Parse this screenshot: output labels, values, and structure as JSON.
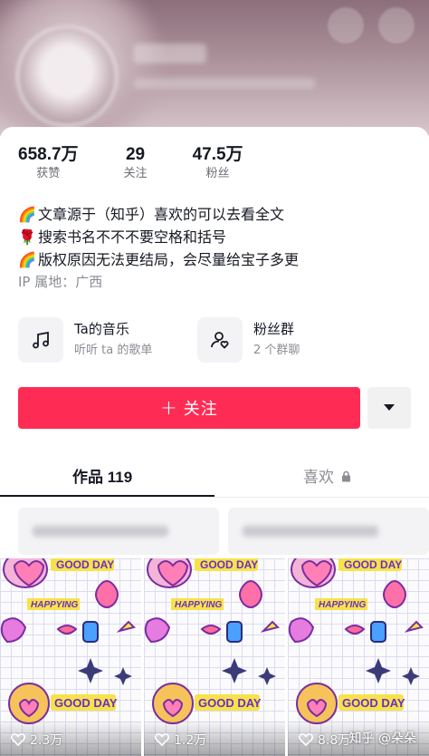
{
  "profile": {
    "stats": [
      {
        "value": "658.7万",
        "label": "获赞"
      },
      {
        "value": "29",
        "label": "关注"
      },
      {
        "value": "47.5万",
        "label": "粉丝"
      }
    ],
    "bio": [
      {
        "emoji": "🌈",
        "text": "文章源于（知乎）喜欢的可以去看全文"
      },
      {
        "emoji": "🌹",
        "text": "搜索书名不不不要空格和括号"
      },
      {
        "emoji": "🌈",
        "text": "版权原因无法更结局，会尽量给宝子多更"
      }
    ],
    "ip": "IP 属地：广西"
  },
  "tiles": [
    {
      "title": "Ta的音乐",
      "sub": "听听 ta 的歌单",
      "icon": "music-note-icon"
    },
    {
      "title": "粉丝群",
      "sub": "2 个群聊",
      "icon": "group-heart-icon"
    }
  ],
  "follow": {
    "label": "关注",
    "plus": "+"
  },
  "tabs": {
    "works": "作品 119",
    "likes": "喜欢"
  },
  "videos": [
    {
      "likes": "2.3万"
    },
    {
      "likes": "1.2万"
    },
    {
      "likes": "8.8万"
    }
  ],
  "watermark": "知乎 @朵朵",
  "colors": {
    "accent": "#fe2c55",
    "text": "#161823",
    "muted": "#8a8c93"
  }
}
